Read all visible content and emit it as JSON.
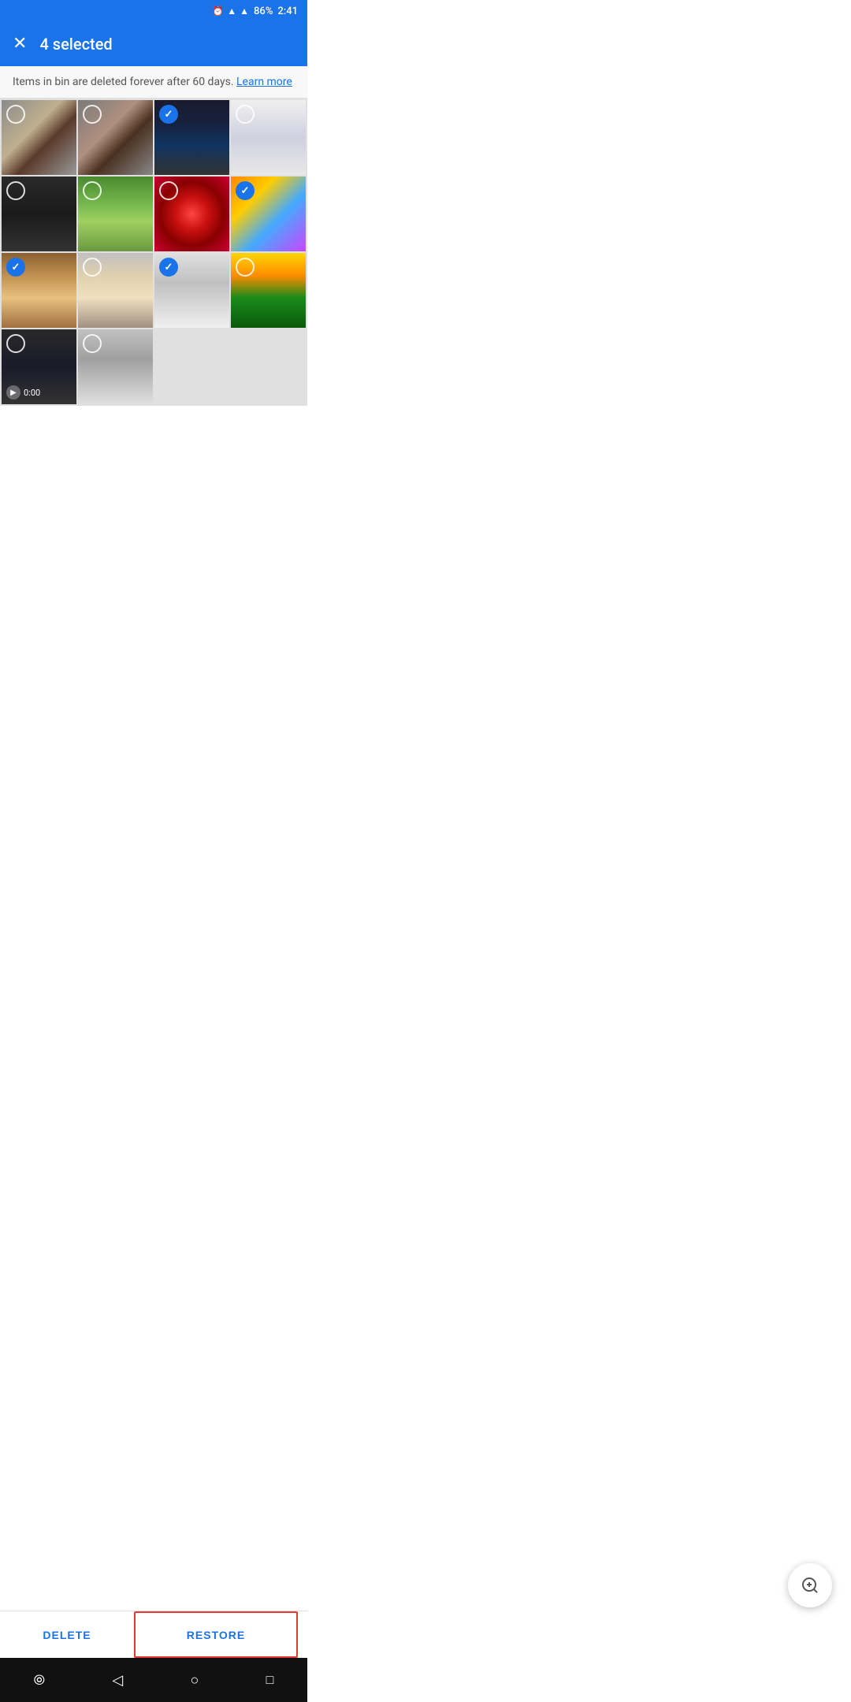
{
  "statusBar": {
    "battery": "86%",
    "time": "2:41",
    "icons": [
      "alarm",
      "wifi",
      "signal",
      "battery"
    ]
  },
  "header": {
    "closeLabel": "✕",
    "title": "4 selected"
  },
  "infoBanner": {
    "text": "Items in bin are deleted forever after 60 days.",
    "linkText": "Learn more"
  },
  "photos": [
    {
      "id": "p1",
      "colorClass": "p1",
      "checked": false,
      "isVideo": false
    },
    {
      "id": "p2",
      "colorClass": "p2",
      "checked": false,
      "isVideo": false
    },
    {
      "id": "p3",
      "colorClass": "p3",
      "checked": true,
      "isVideo": false
    },
    {
      "id": "p4",
      "colorClass": "p4",
      "checked": false,
      "isVideo": false
    },
    {
      "id": "p5",
      "colorClass": "p5",
      "checked": false,
      "isVideo": false
    },
    {
      "id": "p6",
      "colorClass": "p6",
      "checked": false,
      "isVideo": false
    },
    {
      "id": "p7",
      "colorClass": "p7",
      "checked": false,
      "isVideo": false
    },
    {
      "id": "p8",
      "colorClass": "p8",
      "checked": true,
      "isVideo": false
    },
    {
      "id": "p9",
      "colorClass": "p9",
      "checked": true,
      "isVideo": false
    },
    {
      "id": "p10",
      "colorClass": "p10",
      "checked": false,
      "isVideo": false
    },
    {
      "id": "p11",
      "colorClass": "p11",
      "checked": true,
      "isVideo": false
    },
    {
      "id": "p12",
      "colorClass": "p12",
      "checked": false,
      "isVideo": false
    },
    {
      "id": "p13",
      "colorClass": "p13",
      "checked": false,
      "isVideo": true,
      "videoDuration": "0:00"
    },
    {
      "id": "p14",
      "colorClass": "p14",
      "checked": false,
      "isVideo": false
    }
  ],
  "fab": {
    "icon": "⊕",
    "label": "zoom-in"
  },
  "actions": {
    "deleteLabel": "DELETE",
    "restoreLabel": "RESTORE"
  },
  "navBar": {
    "icons": [
      "○",
      "◁",
      "○",
      "□"
    ]
  }
}
